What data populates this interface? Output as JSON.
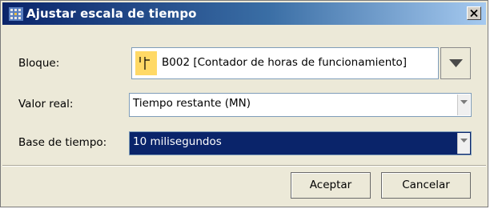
{
  "window": {
    "title": "Ajustar escala de tiempo",
    "close_label": "×"
  },
  "rows": {
    "block": {
      "label": "Bloque:",
      "value": "B002 [Contador de horas de funcionamiento]"
    },
    "real_value": {
      "label": "Valor real:",
      "value": "Tiempo restante (MN)"
    },
    "time_base": {
      "label": "Base de tiempo:",
      "value": "10 milisegundos"
    }
  },
  "buttons": {
    "accept": "Aceptar",
    "cancel": "Cancelar"
  },
  "colors": {
    "title_start": "#0a246a",
    "title_end": "#a6caf0",
    "selection": "#0a246a",
    "block_icon": "#ffd966"
  },
  "icons": {
    "title": "logo-grid-icon",
    "close": "close-icon",
    "block": "counter-block-icon",
    "dropdown": "chevron-down-icon"
  }
}
